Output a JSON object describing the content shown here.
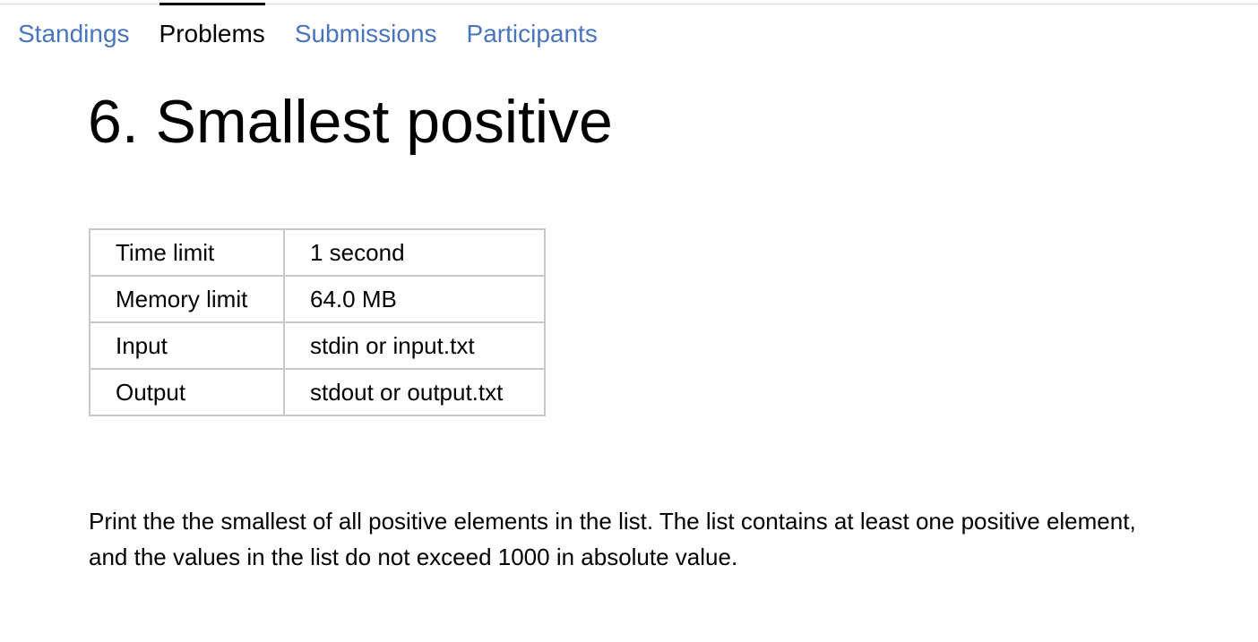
{
  "nav": {
    "tabs": [
      {
        "label": "Standings",
        "active": false
      },
      {
        "label": "Problems",
        "active": true
      },
      {
        "label": "Submissions",
        "active": false
      },
      {
        "label": "Participants",
        "active": false
      }
    ],
    "link_color": "#4a74bd",
    "active_color": "#000000"
  },
  "problem": {
    "title": "6. Smallest positive",
    "limits": [
      {
        "label": "Time limit",
        "value": "1 second"
      },
      {
        "label": "Memory limit",
        "value": "64.0 MB"
      },
      {
        "label": "Input",
        "value": "stdin or input.txt"
      },
      {
        "label": "Output",
        "value": "stdout or output.txt"
      }
    ],
    "statement": "Print the the smallest of all positive elements in the list. The list contains at least one positive element, and the values in the list do not exceed 1000 in absolute value."
  }
}
